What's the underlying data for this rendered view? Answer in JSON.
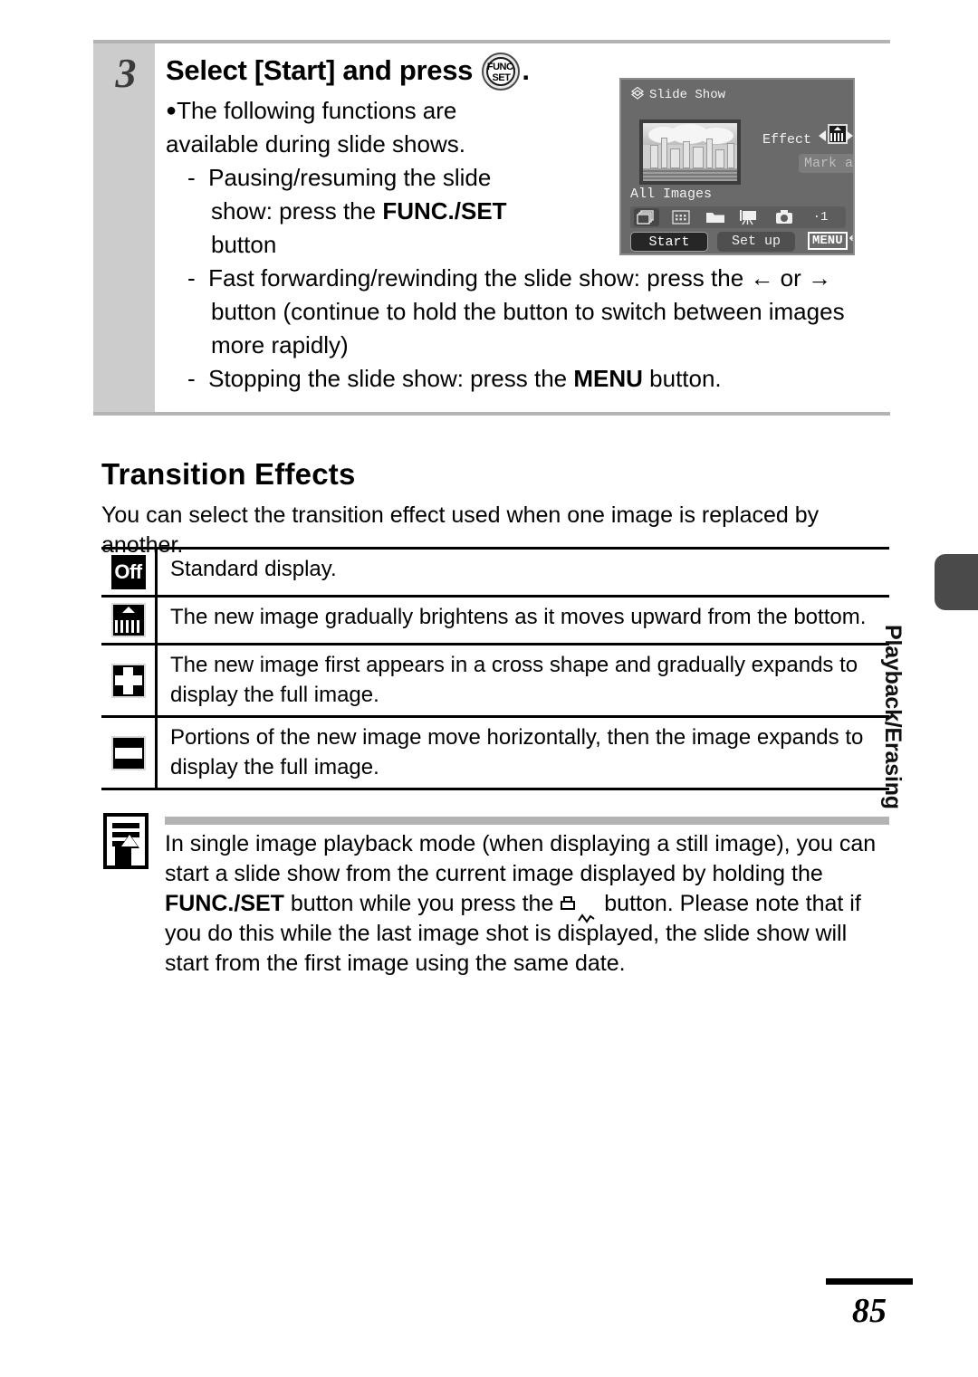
{
  "page": {
    "number": "85",
    "side_tab_label": "Playback/Erasing"
  },
  "step": {
    "number": "3",
    "title_before": "Select [Start] and press",
    "title_after": ".",
    "funcset_icon": {
      "name": "func-set-button-icon",
      "line1": "FUNC.",
      "line2": "SET"
    },
    "bullet": "The following functions are available during slide shows.",
    "dash_items": [
      {
        "pre": "Pausing/resuming the slide show: press the ",
        "bold": "FUNC./SET",
        "post": " button"
      },
      {
        "pre": "Fast forwarding/rewinding the slide show: press the ",
        "left_arrow": "←",
        "mid": " or ",
        "right_arrow": "→",
        "post": " button (continue to hold the button to switch between images more rapidly)"
      },
      {
        "pre": "Stopping the slide show: press the ",
        "bold": "MENU",
        "post": " button."
      }
    ]
  },
  "lcd": {
    "title": "Slide Show",
    "title_icon": "slide-show-icon",
    "effect_label": "Effect",
    "effect_value_icon": "fade-effect-icon",
    "mark_all": "Mark all",
    "all_images": "All Images",
    "icon_row": [
      {
        "name": "all-images-icon",
        "selected": true
      },
      {
        "name": "date-icon",
        "selected": false
      },
      {
        "name": "folder-icon",
        "selected": false
      },
      {
        "name": "movie-icon",
        "selected": false
      },
      {
        "name": "stills-icon",
        "selected": false
      },
      {
        "name": "custom-1-icon",
        "selected": false,
        "label": "·1"
      }
    ],
    "buttons": {
      "start": "Start",
      "set_up": "Set up",
      "menu": "MENU",
      "menu_return_glyph": "↰"
    }
  },
  "transition": {
    "heading": "Transition Effects",
    "intro": "You can select the transition effect used when one image is replaced by another.",
    "rows": [
      {
        "icon": "off-icon",
        "icon_label": "Off",
        "description": "Standard display."
      },
      {
        "icon": "fade-up-icon",
        "icon_label": "",
        "description": "The new image gradually brightens as it moves upward from the bottom."
      },
      {
        "icon": "cross-expand-icon",
        "icon_label": "",
        "description": "The new image first appears in a cross shape and gradually expands to display the full image."
      },
      {
        "icon": "horizontal-scroll-icon",
        "icon_label": "",
        "description": "Portions of the new image move horizontally, then the image expands to display the full image."
      }
    ]
  },
  "note": {
    "icon": "memo-pencil-icon",
    "part1": "In single image playback mode (when displaying a still image), you can start a slide show from the current image displayed by holding the ",
    "bold1": "FUNC./SET",
    "part2": " button while you press the ",
    "button_icon": "print-share-button-icon",
    "part3": " button. Please note that if you do this while the last image shot is displayed, the slide show will start from the first image using the same date."
  },
  "colors": {
    "gray_band": "#cccccc",
    "rule_gray": "#b3b3b3",
    "lcd_background": "#6a6a6a",
    "side_tab": "#4a4a4a",
    "text": "#000000"
  }
}
